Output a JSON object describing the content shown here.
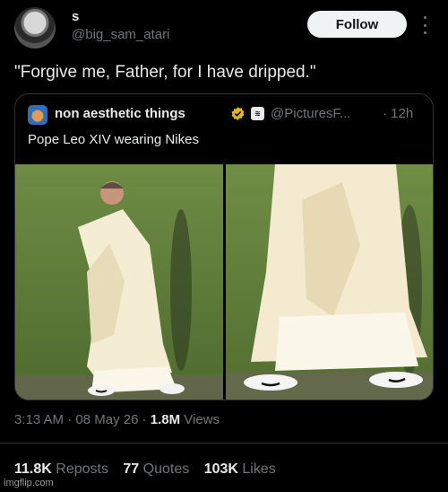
{
  "author": {
    "display_name": "s",
    "handle": "@big_sam_atari",
    "follow_label": "Follow"
  },
  "tweet": {
    "text": "\"Forgive me, Father, for I have dripped.\""
  },
  "quote": {
    "display_name": "non aesthetic things",
    "affiliate_badge": "≋",
    "handle": "@PicturesF...",
    "time": "· 12h",
    "text": "Pope Leo XIV wearing Nikes"
  },
  "meta": {
    "time": "3:13 AM",
    "sep1": " · ",
    "date": "08 May 26",
    "sep2": " · ",
    "views_count": "1.8M",
    "views_label": " Views"
  },
  "stats": {
    "reposts_count": "11.8K",
    "reposts_label": " Reposts",
    "quotes_count": "77",
    "quotes_label": " Quotes",
    "likes_count": "103K",
    "likes_label": " Likes"
  },
  "watermark": "imgflip.com",
  "colors": {
    "background": "#000000",
    "text_primary": "#e7e9ea",
    "text_secondary": "#71767b",
    "border": "#2f3336",
    "verified_gold": "#e2b719",
    "follow_bg": "#eff3f4"
  },
  "icons": [
    "more-options-icon",
    "verified-badge-icon",
    "affiliate-badge-icon"
  ]
}
